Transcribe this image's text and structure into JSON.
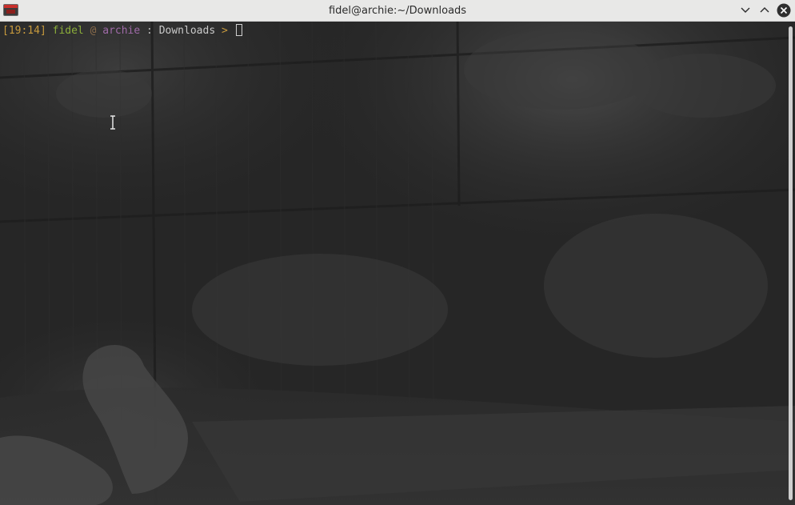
{
  "window": {
    "title": "fidel@archie:~/Downloads",
    "icons": {
      "app": "terminal-app-icon",
      "minimize": "chevron-down-icon",
      "maximize": "chevron-up-icon",
      "close": "close-circle-icon"
    }
  },
  "terminal": {
    "prompt": {
      "time": "[19:14]",
      "user": "fidel",
      "at": "@",
      "host": "archie",
      "separator": ":",
      "directory": "Downloads",
      "symbol": ">"
    },
    "colors": {
      "time": "#c79a3d",
      "user": "#8cae3a",
      "host": "#9f6aa8",
      "symbol": "#c79a3d"
    },
    "cursor_icon": "text-ibeam-icon"
  }
}
